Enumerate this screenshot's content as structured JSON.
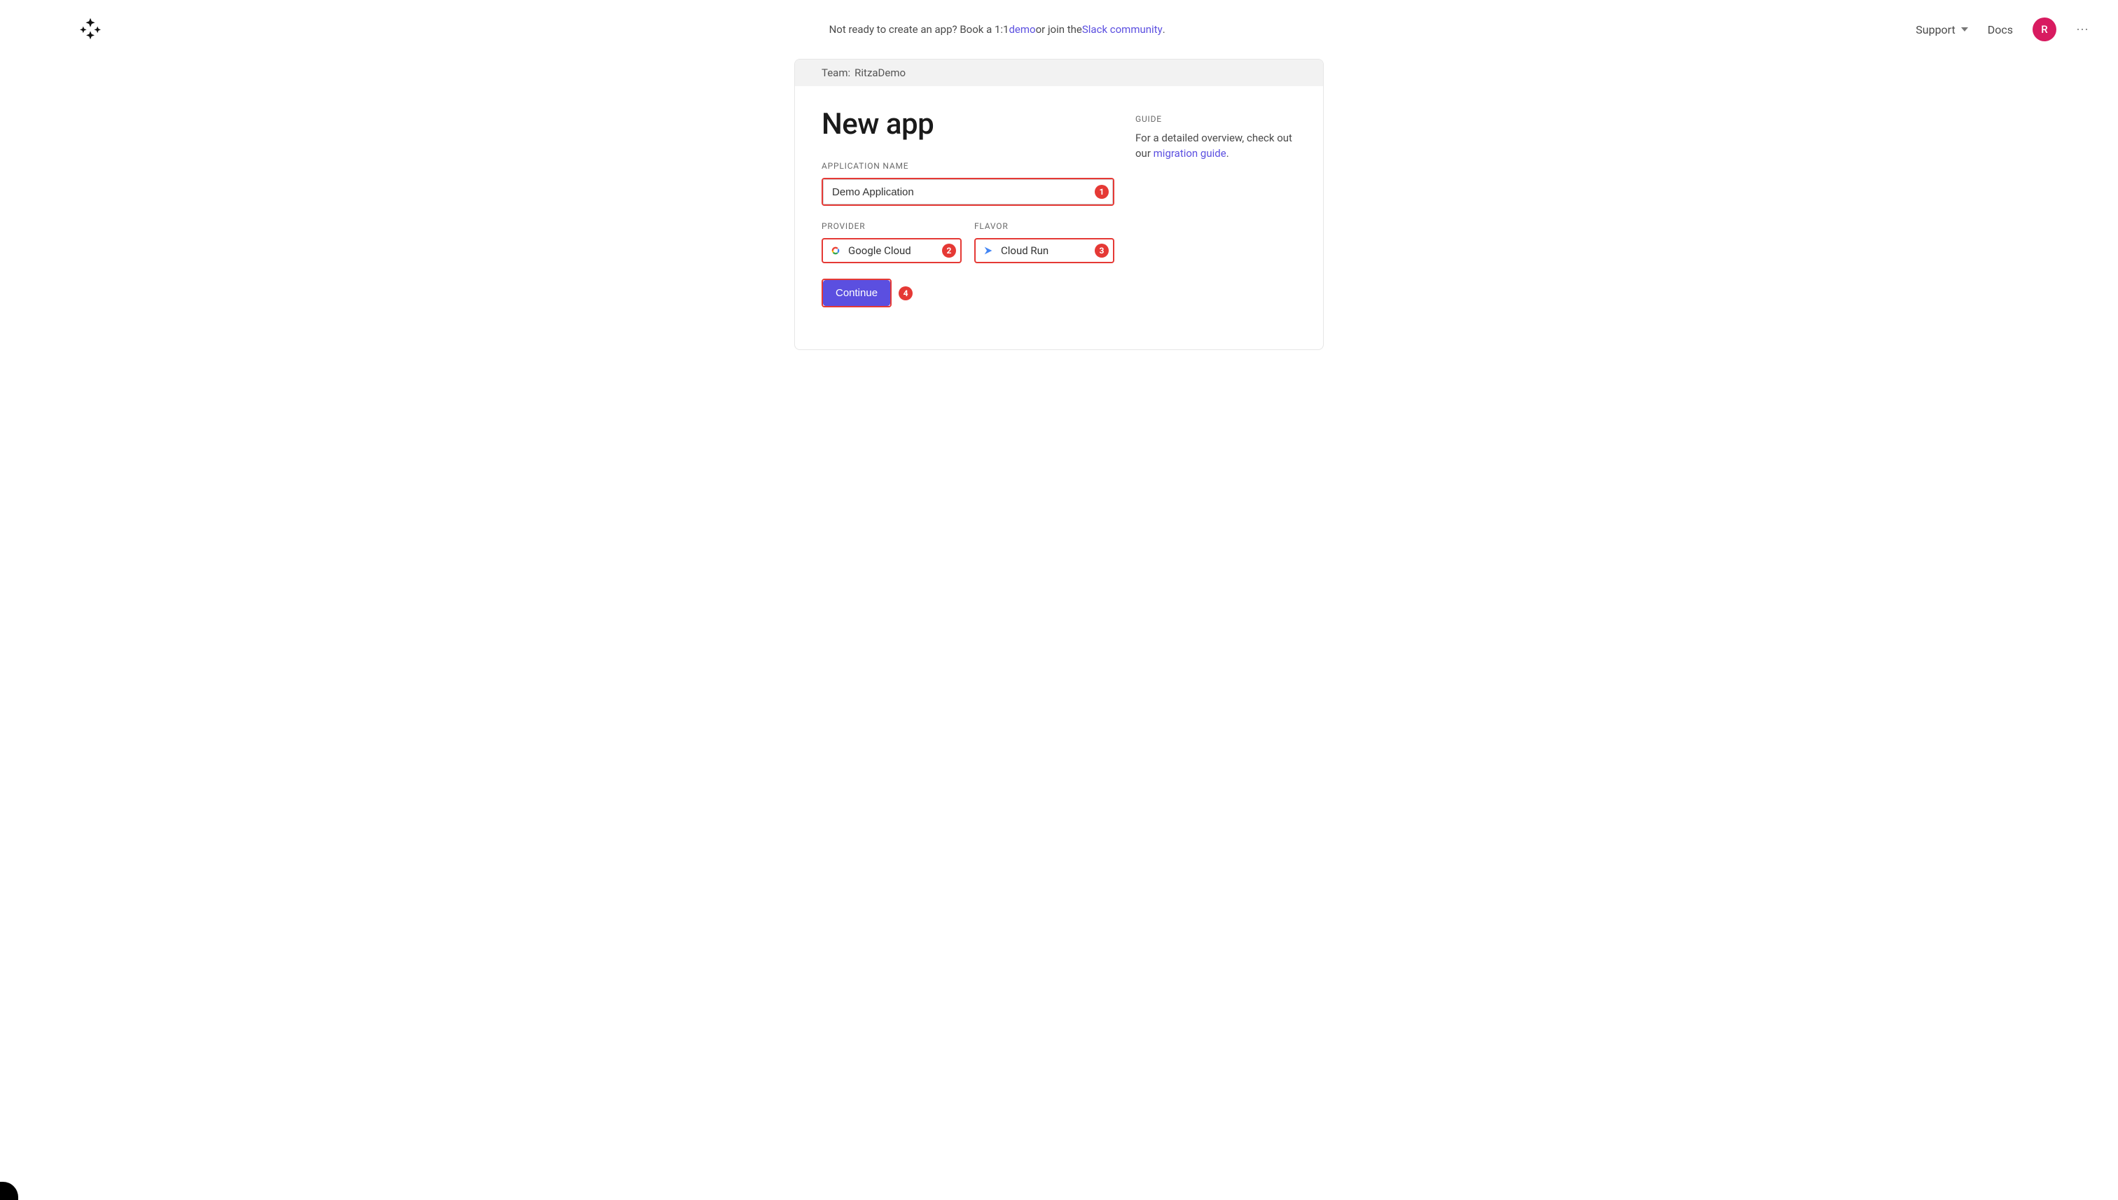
{
  "topbar": {
    "banner_prefix": "Not ready to create an app? Book a 1:1 ",
    "demo_link": "demo",
    "banner_mid": " or join the ",
    "slack_link": "Slack community",
    "banner_suffix": ".",
    "support": "Support",
    "docs": "Docs",
    "avatar_initial": "R"
  },
  "team": {
    "label": "Team:",
    "name": "RitzaDemo"
  },
  "form": {
    "title": "New app",
    "app_name_label": "APPLICATION NAME",
    "app_name_value": "Demo Application",
    "provider_label": "PROVIDER",
    "provider_value": "Google Cloud",
    "flavor_label": "FLAVOR",
    "flavor_value": "Cloud Run",
    "continue": "Continue"
  },
  "annotations": {
    "app_name": "1",
    "provider": "2",
    "flavor": "3",
    "continue": "4"
  },
  "guide": {
    "label": "GUIDE",
    "text_prefix": "For a detailed overview, check out our ",
    "link_text": "migration guide",
    "text_suffix": "."
  }
}
